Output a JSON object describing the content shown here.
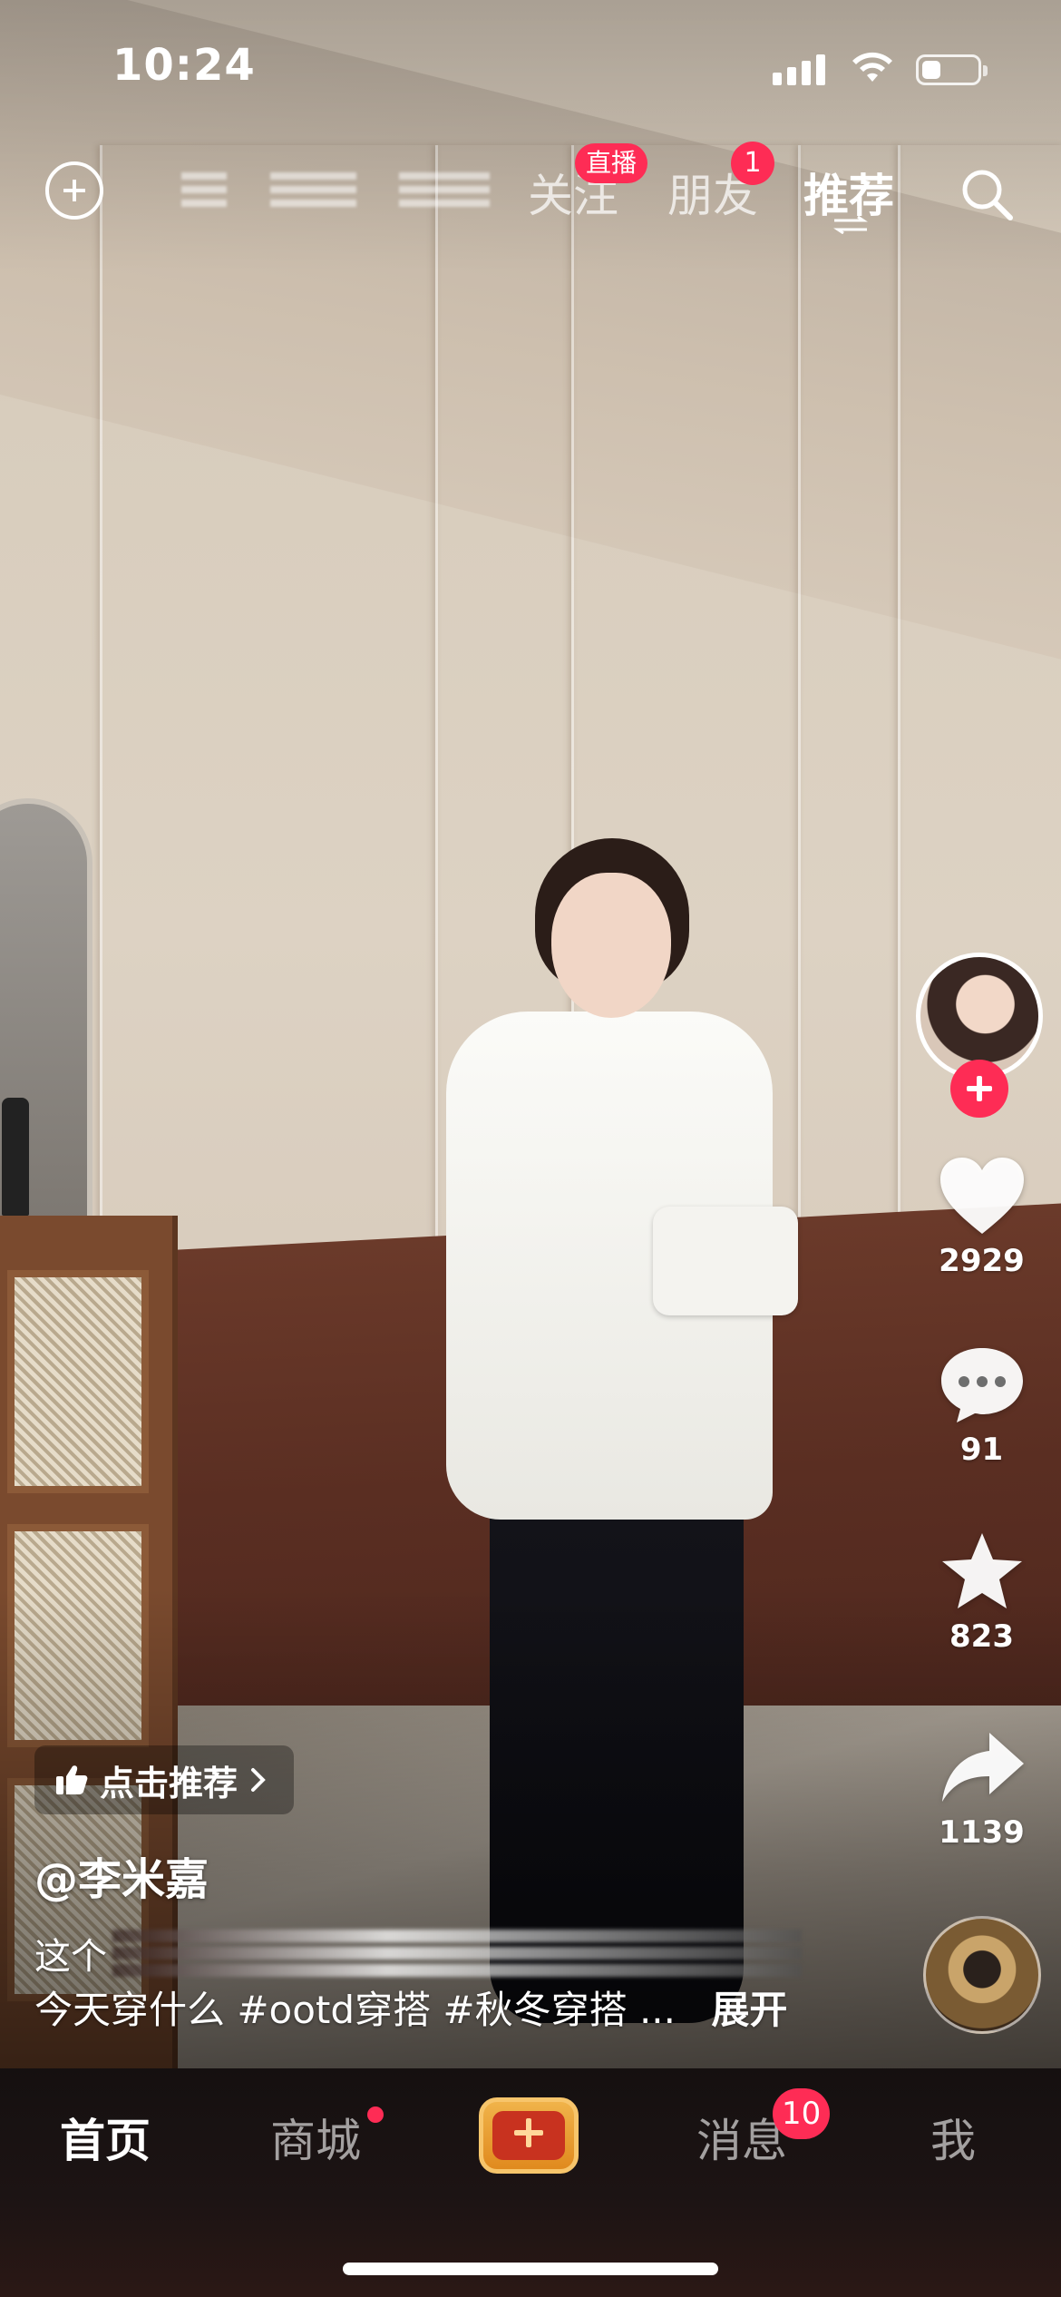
{
  "status_bar": {
    "time": "10:24",
    "battery_level": 0.35
  },
  "top_nav": {
    "tabs": [
      {
        "label": "关注",
        "badge": "直播"
      },
      {
        "label": "朋友",
        "badge": "1"
      },
      {
        "label": "推荐",
        "active": true
      }
    ]
  },
  "rail": {
    "likes": "2929",
    "comments": "91",
    "favorites": "823",
    "shares": "1139"
  },
  "recommend": {
    "label": "点击推荐"
  },
  "post": {
    "author": "@李米嘉",
    "caption_prefix": "这个",
    "caption": "今天穿什么 #ootd穿搭 #秋冬穿搭 ...",
    "expand_label": "展开"
  },
  "tab_bar": {
    "home": "首页",
    "mall": "商城",
    "messages": "消息",
    "messages_badge": "10",
    "me": "我"
  },
  "colors": {
    "accent": "#fe2c55",
    "create_button": "#e08a1e"
  },
  "icons": [
    "add-circle-icon",
    "search-icon",
    "heart-icon",
    "comment-icon",
    "star-icon",
    "share-icon",
    "thumbs-up-icon",
    "chevron-right-icon",
    "plus-icon"
  ]
}
